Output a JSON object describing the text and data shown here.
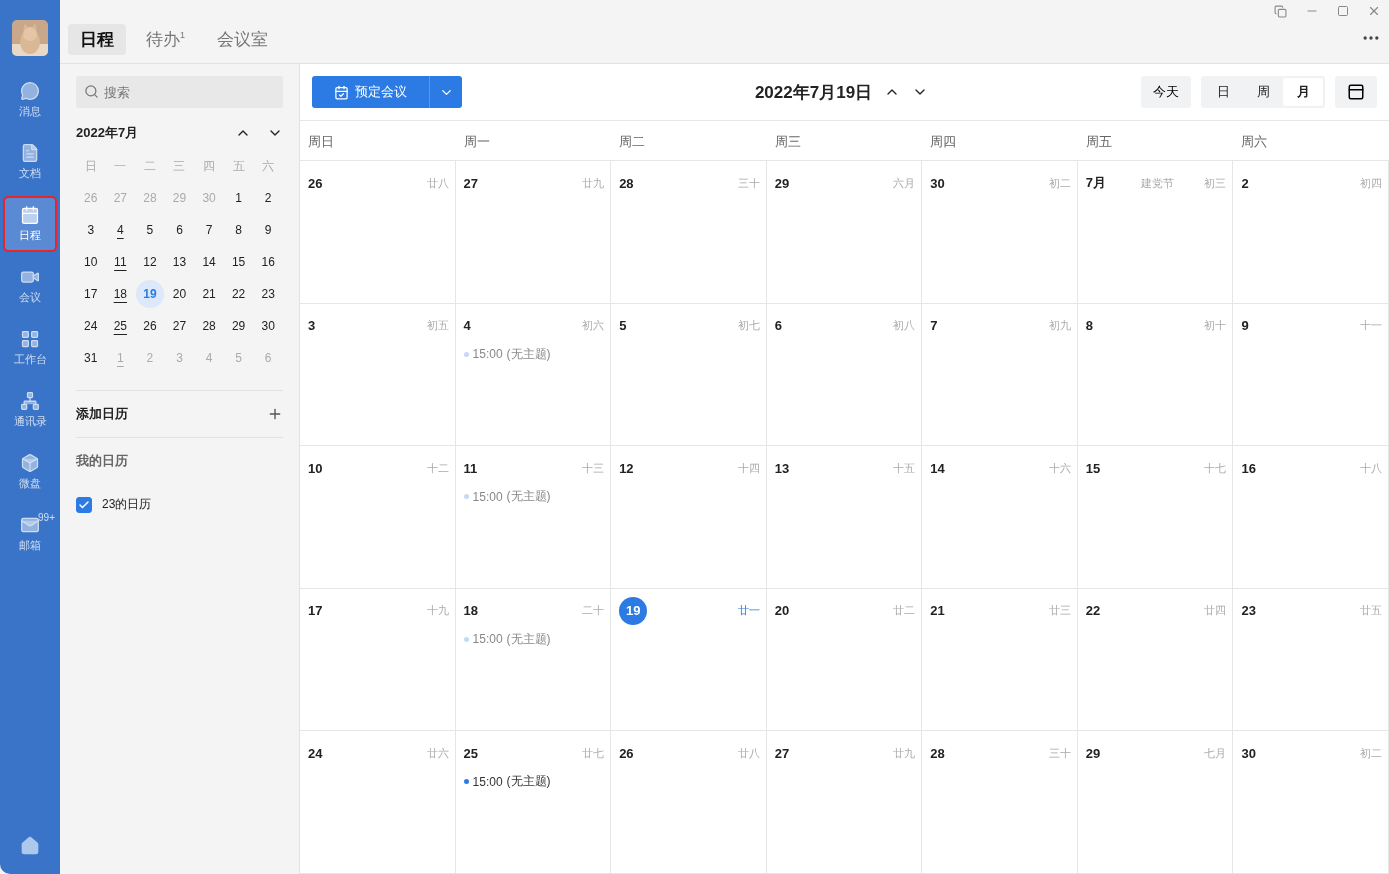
{
  "nav_rail": {
    "items": [
      {
        "label": "消息",
        "selected": false
      },
      {
        "label": "文档",
        "selected": false
      },
      {
        "label": "日程",
        "selected": true
      },
      {
        "label": "会议",
        "selected": false
      },
      {
        "label": "工作台",
        "selected": false
      },
      {
        "label": "通讯录",
        "selected": false
      },
      {
        "label": "微盘",
        "selected": false
      },
      {
        "label": "邮箱",
        "selected": false,
        "badge": "99+"
      }
    ]
  },
  "top_tabs": [
    {
      "label": "日程",
      "selected": true
    },
    {
      "label": "待办$^{1}$",
      "selected": false
    },
    {
      "label": "会议室",
      "selected": false
    }
  ],
  "sidebar": {
    "search": {
      "placeholder": "搜索"
    },
    "mini_calendar": {
      "title": "2022年7月",
      "weekdays": [
        "日",
        "一",
        "二",
        "三",
        "四",
        "五",
        "六"
      ],
      "days": [
        {
          "label": "26",
          "muted": true,
          "marked": false,
          "selected": false
        },
        {
          "label": "27",
          "muted": true,
          "marked": false,
          "selected": false
        },
        {
          "label": "28",
          "muted": true,
          "marked": false,
          "selected": false
        },
        {
          "label": "29",
          "muted": true,
          "marked": false,
          "selected": false
        },
        {
          "label": "30",
          "muted": true,
          "marked": false,
          "selected": false
        },
        {
          "label": "1",
          "muted": false,
          "marked": false,
          "selected": false
        },
        {
          "label": "2",
          "muted": false,
          "marked": false,
          "selected": false
        },
        {
          "label": "3",
          "muted": false,
          "marked": false,
          "selected": false
        },
        {
          "label": "4",
          "muted": false,
          "marked": true,
          "selected": false
        },
        {
          "label": "5",
          "muted": false,
          "marked": false,
          "selected": false
        },
        {
          "label": "6",
          "muted": false,
          "marked": false,
          "selected": false
        },
        {
          "label": "7",
          "muted": false,
          "marked": false,
          "selected": false
        },
        {
          "label": "8",
          "muted": false,
          "marked": false,
          "selected": false
        },
        {
          "label": "9",
          "muted": false,
          "marked": false,
          "selected": false
        },
        {
          "label": "10",
          "muted": false,
          "marked": false,
          "selected": false
        },
        {
          "label": "11",
          "muted": false,
          "marked": true,
          "selected": false
        },
        {
          "label": "12",
          "muted": false,
          "marked": false,
          "selected": false
        },
        {
          "label": "13",
          "muted": false,
          "marked": false,
          "selected": false
        },
        {
          "label": "14",
          "muted": false,
          "marked": false,
          "selected": false
        },
        {
          "label": "15",
          "muted": false,
          "marked": false,
          "selected": false
        },
        {
          "label": "16",
          "muted": false,
          "marked": false,
          "selected": false
        },
        {
          "label": "17",
          "muted": false,
          "marked": false,
          "selected": false
        },
        {
          "label": "18",
          "muted": false,
          "marked": true,
          "selected": false
        },
        {
          "label": "19",
          "muted": false,
          "marked": false,
          "selected": true
        },
        {
          "label": "20",
          "muted": false,
          "marked": false,
          "selected": false
        },
        {
          "label": "21",
          "muted": false,
          "marked": false,
          "selected": false
        },
        {
          "label": "22",
          "muted": false,
          "marked": false,
          "selected": false
        },
        {
          "label": "23",
          "muted": false,
          "marked": false,
          "selected": false
        },
        {
          "label": "24",
          "muted": false,
          "marked": false,
          "selected": false
        },
        {
          "label": "25",
          "muted": false,
          "marked": true,
          "selected": false
        },
        {
          "label": "26",
          "muted": false,
          "marked": false,
          "selected": false
        },
        {
          "label": "27",
          "muted": false,
          "marked": false,
          "selected": false
        },
        {
          "label": "28",
          "muted": false,
          "marked": false,
          "selected": false
        },
        {
          "label": "29",
          "muted": false,
          "marked": false,
          "selected": false
        },
        {
          "label": "30",
          "muted": false,
          "marked": false,
          "selected": false
        },
        {
          "label": "31",
          "muted": false,
          "marked": false,
          "selected": false
        },
        {
          "label": "1",
          "muted": true,
          "marked": true,
          "selected": false
        },
        {
          "label": "2",
          "muted": true,
          "marked": false,
          "selected": false
        },
        {
          "label": "3",
          "muted": true,
          "marked": false,
          "selected": false
        },
        {
          "label": "4",
          "muted": true,
          "marked": false,
          "selected": false
        },
        {
          "label": "5",
          "muted": true,
          "marked": false,
          "selected": false
        },
        {
          "label": "6",
          "muted": true,
          "marked": false,
          "selected": false
        }
      ]
    },
    "add_calendar": "添加日历",
    "my_calendars": {
      "title": "我的日历",
      "items": [
        {
          "label": "23的日历",
          "checked": true
        }
      ]
    }
  },
  "toolbar": {
    "book_button": "预定会议",
    "date_title": "2022年7月19日",
    "today_button": "今天",
    "views": [
      {
        "label": "日",
        "selected": false
      },
      {
        "label": "周",
        "selected": false
      },
      {
        "label": "月",
        "selected": true
      }
    ]
  },
  "month": {
    "weekdays": [
      "周日",
      "周一",
      "周二",
      "周三",
      "周四",
      "周五",
      "周六"
    ],
    "cells": [
      {
        "day": "26",
        "lunar": "廿八",
        "today": false
      },
      {
        "day": "27",
        "lunar": "廿九",
        "today": false
      },
      {
        "day": "28",
        "lunar": "三十",
        "today": false
      },
      {
        "day": "29",
        "lunar": "六月",
        "today": false
      },
      {
        "day": "30",
        "lunar": "初二",
        "today": false
      },
      {
        "day": "7月",
        "festival": "建党节",
        "lunar": "初三",
        "today": false
      },
      {
        "day": "2",
        "lunar": "初四",
        "today": false
      },
      {
        "day": "3",
        "lunar": "初五",
        "today": false
      },
      {
        "day": "4",
        "lunar": "初六",
        "today": false,
        "events": [
          {
            "time": "15:00",
            "title": "(无主题)",
            "past": true
          }
        ]
      },
      {
        "day": "5",
        "lunar": "初七",
        "today": false
      },
      {
        "day": "6",
        "lunar": "初八",
        "today": false
      },
      {
        "day": "7",
        "lunar": "初九",
        "today": false
      },
      {
        "day": "8",
        "lunar": "初十",
        "today": false
      },
      {
        "day": "9",
        "lunar": "十一",
        "today": false
      },
      {
        "day": "10",
        "lunar": "十二",
        "today": false
      },
      {
        "day": "11",
        "lunar": "十三",
        "today": false,
        "events": [
          {
            "time": "15:00",
            "title": "(无主题)",
            "past": true
          }
        ]
      },
      {
        "day": "12",
        "lunar": "十四",
        "today": false
      },
      {
        "day": "13",
        "lunar": "十五",
        "today": false
      },
      {
        "day": "14",
        "lunar": "十六",
        "today": false
      },
      {
        "day": "15",
        "lunar": "十七",
        "today": false
      },
      {
        "day": "16",
        "lunar": "十八",
        "today": false
      },
      {
        "day": "17",
        "lunar": "十九",
        "today": false
      },
      {
        "day": "18",
        "lunar": "二十",
        "today": false,
        "events": [
          {
            "time": "15:00",
            "title": "(无主题)",
            "past": true
          }
        ]
      },
      {
        "day": "19",
        "lunar": "廿一",
        "today": true
      },
      {
        "day": "20",
        "lunar": "廿二",
        "today": false
      },
      {
        "day": "21",
        "lunar": "廿三",
        "today": false
      },
      {
        "day": "22",
        "lunar": "廿四",
        "today": false
      },
      {
        "day": "23",
        "lunar": "廿五",
        "today": false
      },
      {
        "day": "24",
        "lunar": "廿六",
        "today": false
      },
      {
        "day": "25",
        "lunar": "廿七",
        "today": false,
        "events": [
          {
            "time": "15:00",
            "title": "(无主题)",
            "past": false
          }
        ]
      },
      {
        "day": "26",
        "lunar": "廿八",
        "today": false
      },
      {
        "day": "27",
        "lunar": "廿九",
        "today": false
      },
      {
        "day": "28",
        "lunar": "三十",
        "today": false
      },
      {
        "day": "29",
        "lunar": "七月",
        "today": false
      },
      {
        "day": "30",
        "lunar": "初二",
        "today": false
      }
    ]
  }
}
